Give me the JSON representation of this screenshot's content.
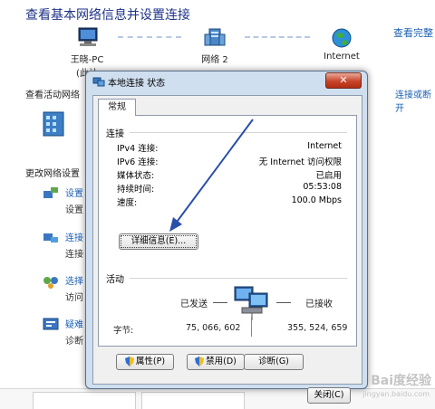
{
  "background": {
    "title": "查看基本网络信息并设置连接",
    "right_link": "查看完整",
    "nodes": [
      {
        "label": "王晓-PC",
        "sublabel": "(此计"
      },
      {
        "label": "网络 2"
      },
      {
        "label": "Internet"
      }
    ],
    "active_networks_label": "查看活动网络",
    "connect_disconnect_link": "连接或断开",
    "change_settings_label": "更改网络设置",
    "tasks": [
      {
        "link": "设置",
        "sub": "设置"
      },
      {
        "link": "连接",
        "sub": "连接"
      },
      {
        "link": "选择",
        "sub": "访问"
      },
      {
        "link": "疑难",
        "sub": "诊断"
      }
    ]
  },
  "dialog": {
    "title": "本地连接 状态",
    "close_glyph": "✕",
    "tab_label": "常规",
    "connection": {
      "group_label": "连接",
      "rows": [
        {
          "label": "IPv4 连接:",
          "value": "Internet"
        },
        {
          "label": "IPv6 连接:",
          "value": "无 Internet 访问权限"
        },
        {
          "label": "媒体状态:",
          "value": "已启用"
        },
        {
          "label": "持续时间:",
          "value": "05:53:08"
        },
        {
          "label": "速度:",
          "value": "100.0 Mbps"
        }
      ],
      "details_button": "详细信息(E)..."
    },
    "activity": {
      "group_label": "活动",
      "sent_label": "已发送",
      "received_label": "已接收",
      "bytes_label": "字节:",
      "bytes_sent": "75, 066, 602",
      "bytes_received": "355, 524, 659"
    },
    "buttons": {
      "properties": "属性(P)",
      "disable": "禁用(D)",
      "diagnose": "诊断(G)",
      "close": "关闭(C)"
    }
  },
  "watermark": {
    "text": "Bai度经验",
    "sub": "jingyan.baidu.com"
  },
  "colors": {
    "title_blue": "#1e3287",
    "link_blue": "#1a5fb4",
    "dialog_frame": "#cfdff0",
    "close_red": "#c7452a",
    "annotation_arrow": "#2a4fa8"
  }
}
